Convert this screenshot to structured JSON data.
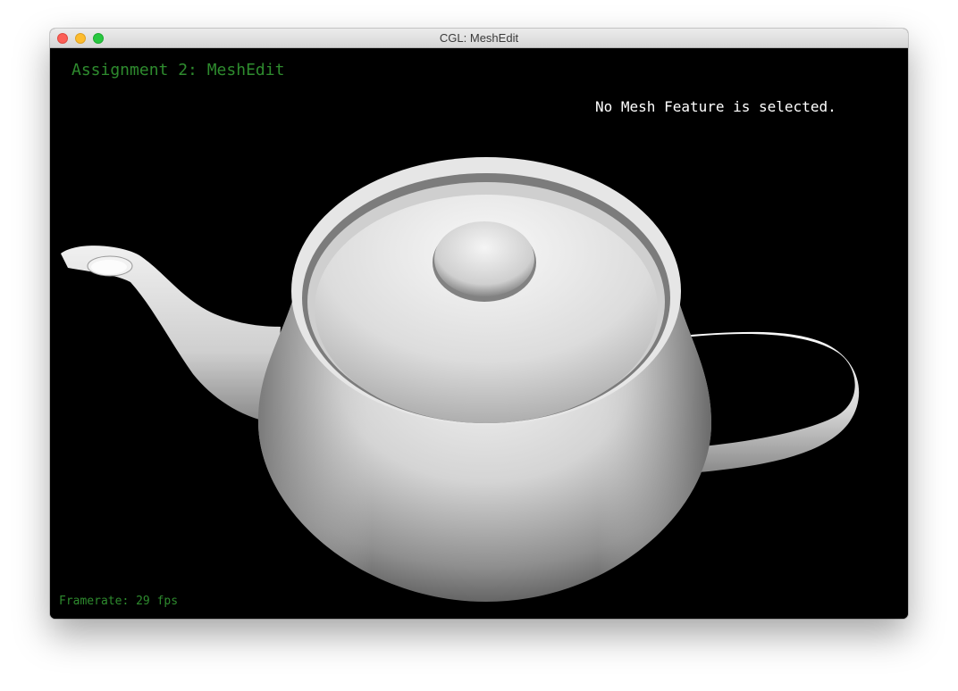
{
  "window": {
    "title": "CGL: MeshEdit"
  },
  "hud": {
    "title": "Assignment 2: MeshEdit",
    "status": "No Mesh Feature is selected.",
    "framerate": "Framerate: 29 fps"
  },
  "scene": {
    "object": "teapot",
    "background_color": "#000000",
    "hud_accent_color": "#2e8b2e"
  }
}
